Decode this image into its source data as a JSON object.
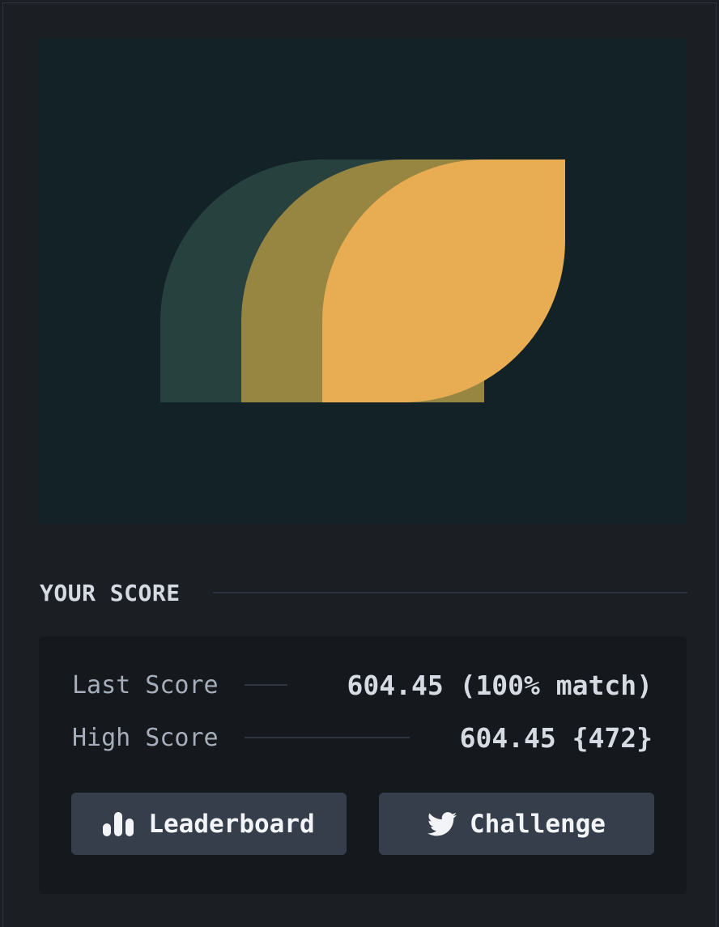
{
  "puzzle": {
    "shapes": [
      {
        "name": "back-leaf",
        "color": "#27413f"
      },
      {
        "name": "middle-leaf",
        "color": "#978542"
      },
      {
        "name": "front-leaf",
        "color": "#e8ad52"
      }
    ],
    "background": "#132226"
  },
  "score_section": {
    "title": "YOUR SCORE",
    "last_score": {
      "label": "Last Score",
      "value": "604.45 (100% match)"
    },
    "high_score": {
      "label": "High Score",
      "value": "604.45 {472}"
    }
  },
  "buttons": {
    "leaderboard": {
      "label": "Leaderboard",
      "icon": "bar-chart-icon"
    },
    "challenge": {
      "label": "Challenge",
      "icon": "twitter-icon"
    }
  },
  "colors": {
    "page_bg": "#1b1e22",
    "card_bg": "#15181c",
    "button_bg": "#353e4a",
    "accent": "#e8ad52"
  }
}
